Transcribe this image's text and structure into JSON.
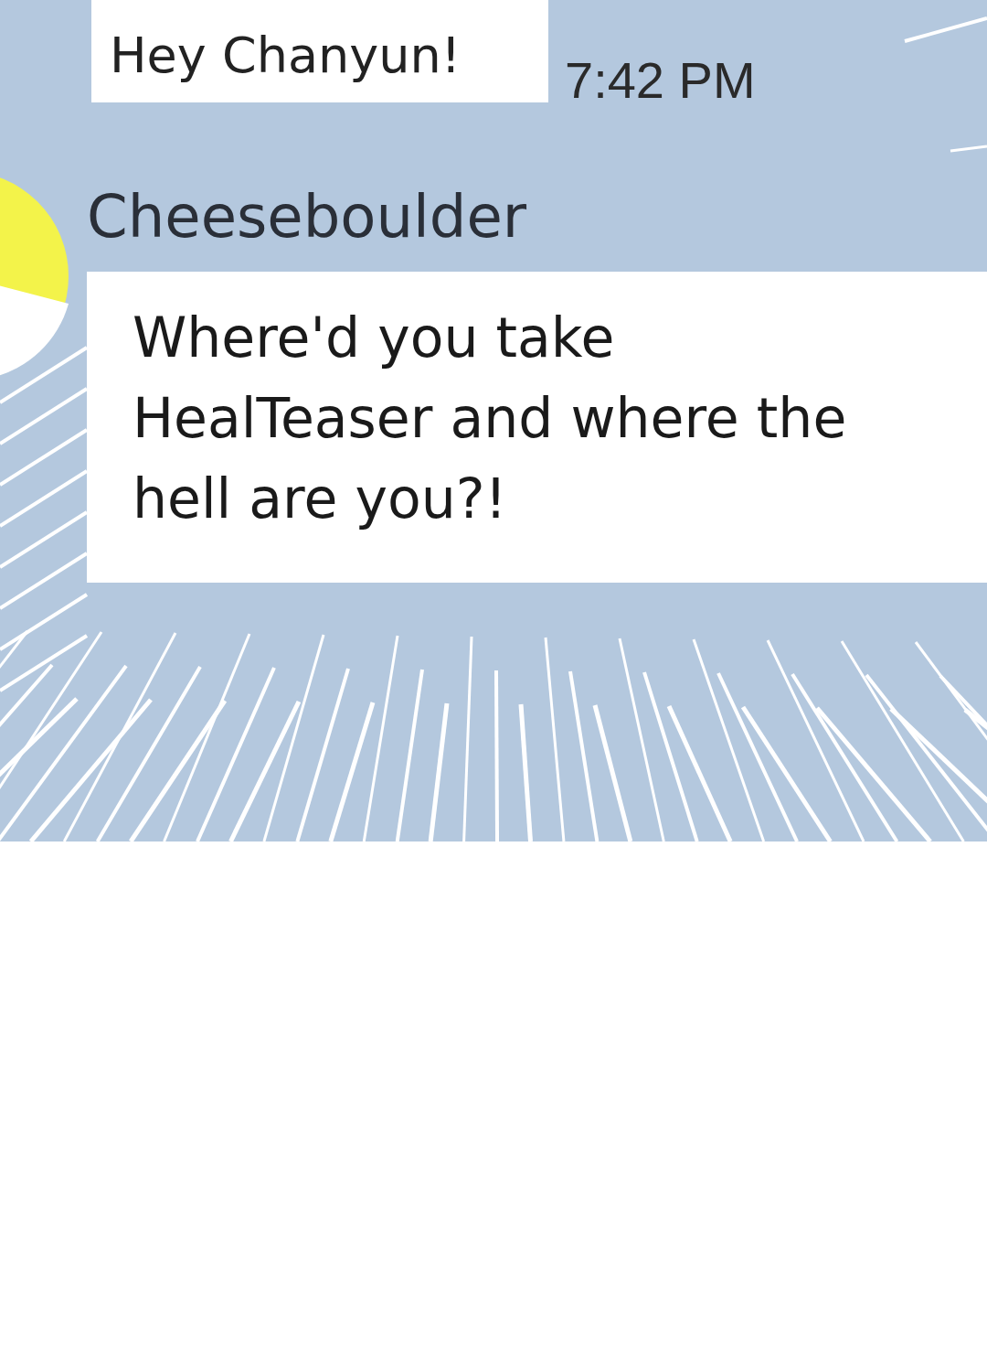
{
  "messages": [
    {
      "kind": "outgoing",
      "text": "Hey Chanyun!",
      "time": "7:42 PM"
    },
    {
      "kind": "incoming",
      "sender": "Cheeseboulder",
      "text": "Where'd you take HealTeaser and where the hell are you?!"
    }
  ]
}
